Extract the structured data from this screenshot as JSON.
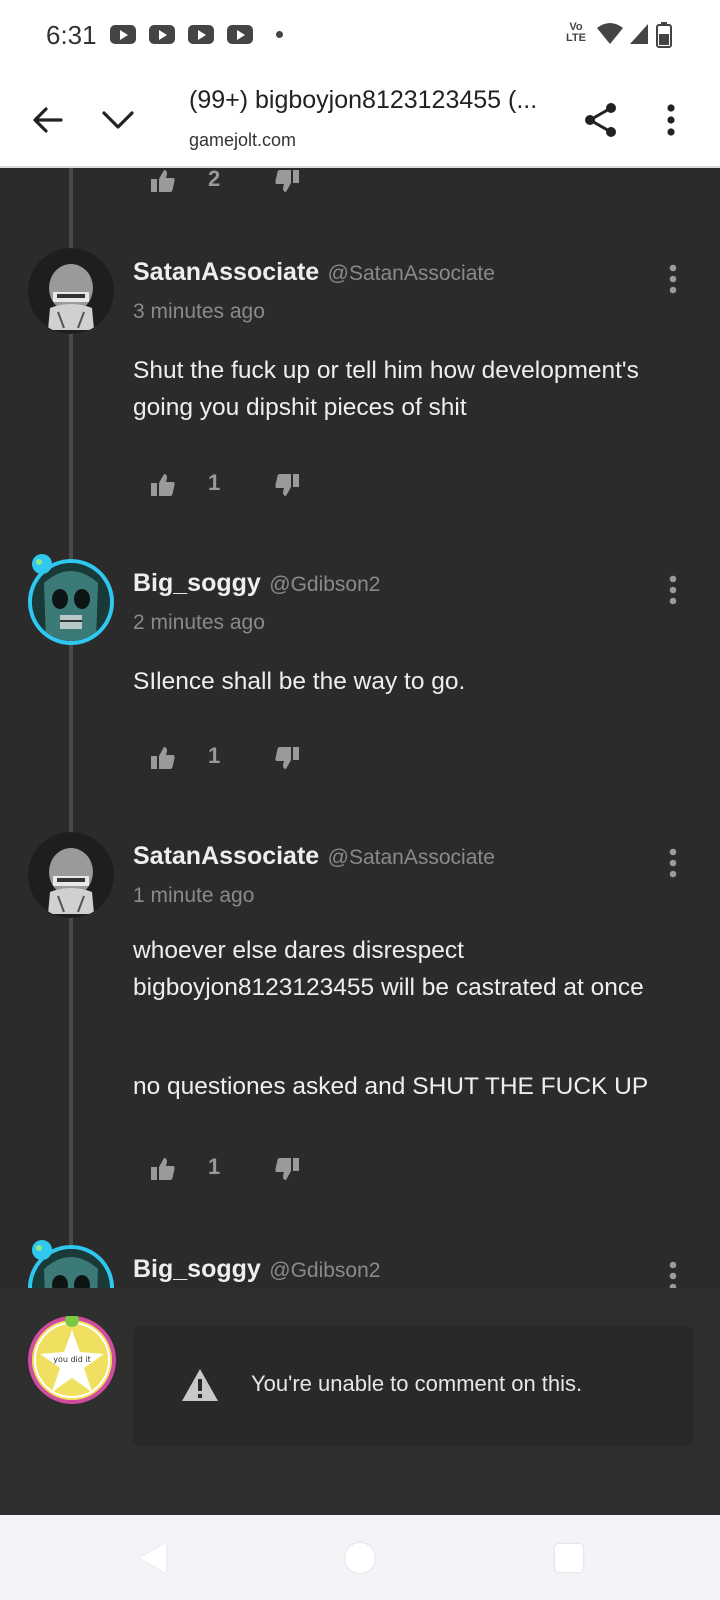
{
  "status_bar": {
    "time": "6:31",
    "network_label": "Vo LTE"
  },
  "browser": {
    "tab_title": "(99+) bigboyjon8123123455 (...",
    "domain": "gamejolt.com"
  },
  "top_vote": {
    "likes": "2"
  },
  "comments": [
    {
      "username": "SatanAssociate",
      "handle": "@SatanAssociate",
      "time_ago": "3 minutes ago",
      "paragraphs": [
        "Shut the fuck up or tell him how development's going you dipshit pieces of shit"
      ],
      "likes": "1"
    },
    {
      "username": "Big_soggy",
      "handle": "@Gdibson2",
      "time_ago": "2 minutes ago",
      "paragraphs": [
        "SIlence shall be the way to go."
      ],
      "likes": "1"
    },
    {
      "username": "SatanAssociate",
      "handle": "@SatanAssociate",
      "time_ago": "1 minute ago",
      "paragraphs": [
        "whoever else dares disrespect bigboyjon8123123455 will be castrated at once",
        "no questiones asked and SHUT THE FUCK UP"
      ],
      "likes": "1"
    },
    {
      "username": "Big_soggy",
      "handle": "@Gdibson2"
    }
  ],
  "composer": {
    "avatar_text": "you did it",
    "notice": "You're unable to comment on this."
  },
  "colors": {
    "background": "#2b2b2b",
    "text": "#eeeeee",
    "muted": "#8a8a8a",
    "soggy_ring": "#2ec8f0",
    "composer_ring": "#d04aa0"
  }
}
